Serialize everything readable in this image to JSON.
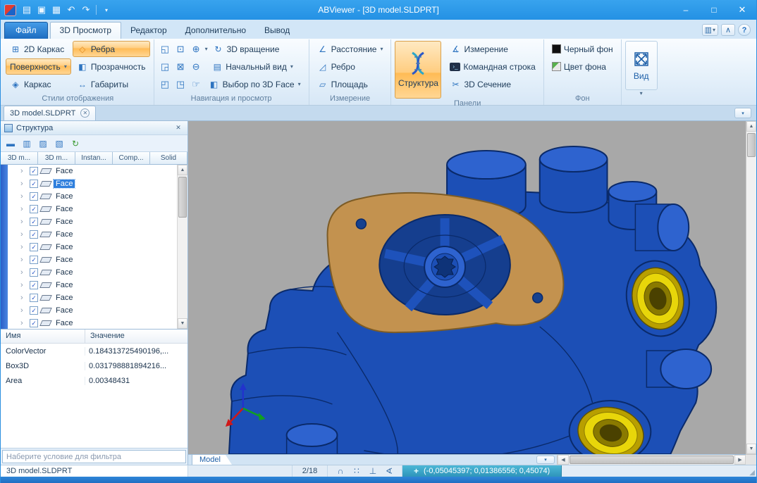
{
  "window": {
    "title": "ABViewer  - [3D model.SLDPRT]"
  },
  "icons": {
    "dropdown": "▾",
    "minimize": "–",
    "maximize": "□",
    "close": "✕",
    "new": "▤",
    "open": "▣",
    "save": "▦",
    "undo": "↶",
    "redo": "↷",
    "window_menu": "▥",
    "collapse_ribbon": "∧",
    "help": "?",
    "wireframe2d": "⊞",
    "edges": "◇",
    "surface": "◆",
    "transparency": "◧",
    "wireframe": "◈",
    "extents": "↔",
    "nav1": "◱",
    "nav2": "⊡",
    "nav3": "◲",
    "nav4": "⊠",
    "nav5": "◰",
    "nav6": "◳",
    "nav7": "☞",
    "zoom_in": "⊕",
    "zoom_out": "⊖",
    "rotate3d": "↻",
    "initial_view": "▤",
    "select_face": "◧",
    "distance": "∠",
    "edge": "◿",
    "area": "▱",
    "measure_panel": "∡",
    "section3d": "✂",
    "panel_toolbar": [
      "▬",
      "▥",
      "▨",
      "▧",
      "↻"
    ],
    "tree_expand": "›",
    "check": "✓",
    "magnet": "∩",
    "grid": "∷",
    "perp": "⊥",
    "angle": "∢",
    "coords_cross": "+",
    "up": "▲",
    "down": "▼",
    "left": "◀",
    "right": "▶"
  },
  "tabs": {
    "file": "Файл",
    "view3d": "3D Просмотр",
    "editor": "Редактор",
    "advanced": "Дополнительно",
    "output": "Вывод"
  },
  "ribbon": {
    "display_styles": {
      "label": "Стили отображения",
      "wireframe2d": "2D Каркас",
      "edges": "Ребра",
      "surface": "Поверхность",
      "transparency": "Прозрачность",
      "wireframe": "Каркас",
      "extents": "Габариты"
    },
    "navigation": {
      "label": "Навигация и просмотр",
      "rotate3d": "3D вращение",
      "initial_view": "Начальный вид",
      "select_by_face": "Выбор по 3D Face"
    },
    "measure": {
      "label": "Измерение",
      "distance": "Расстояние",
      "edge": "Ребро",
      "area": "Площадь"
    },
    "panels": {
      "label": "Панели",
      "structure": "Структура",
      "measure": "Измерение",
      "command_line": "Командная строка",
      "section3d": "3D Сечение"
    },
    "background": {
      "label": "Фон",
      "black": "Черный фон",
      "color": "Цвет фона"
    },
    "view": {
      "label": "Вид"
    }
  },
  "document_tab": {
    "title": "3D model.SLDPRT"
  },
  "structure_panel": {
    "title": "Структура",
    "tabs": [
      "3D m...",
      "3D m...",
      "Instan...",
      "Comp...",
      "Solid"
    ],
    "tree": {
      "items": [
        "Face",
        "Face",
        "Face",
        "Face",
        "Face",
        "Face",
        "Face",
        "Face",
        "Face",
        "Face",
        "Face",
        "Face",
        "Face"
      ],
      "selected_index": 1
    },
    "properties": {
      "name_header": "Имя",
      "value_header": "Значение",
      "rows": [
        {
          "name": "ColorVector",
          "value": "0.184313725490196,..."
        },
        {
          "name": "Box3D",
          "value": "0.031798881894216..."
        },
        {
          "name": "Area",
          "value": "0.00348431"
        }
      ]
    },
    "filter_placeholder": "Наберите условие для фильтра"
  },
  "viewport": {
    "model_tab": "Model"
  },
  "status_bar": {
    "file_name": "3D model.SLDPRT",
    "page": "2/18",
    "coordinates": "(-0,05045397; 0,01386556; 0,45074)"
  },
  "colors": {
    "titlebar": "#2b99e8",
    "active_toggle": "#ffcd80",
    "viewport_bg": "#a8a8a8",
    "model_blue": "#1c4fb6",
    "gasket_tan": "#c3924f",
    "port_yellow": "#e8d60a",
    "coords_bg": "#3aa8cc",
    "file_tab_blue": "#1d6cc0"
  }
}
